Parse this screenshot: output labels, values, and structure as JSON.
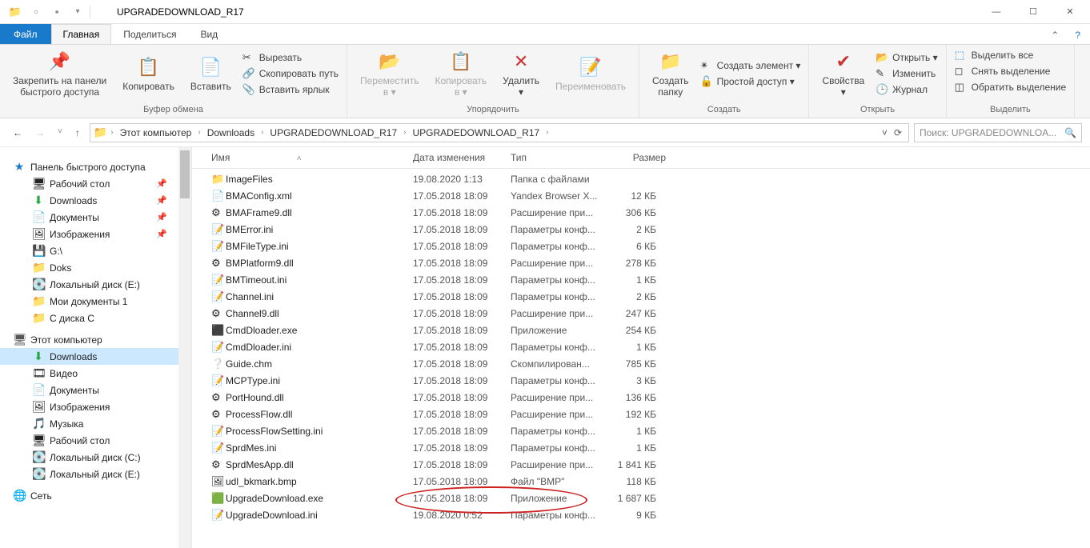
{
  "window": {
    "title": "UPGRADEDOWNLOAD_R17"
  },
  "tabs": {
    "file": "Файл",
    "home": "Главная",
    "share": "Поделиться",
    "view": "Вид"
  },
  "ribbon": {
    "clipboard": {
      "pin": "Закрепить на панели\nбыстрого доступа",
      "copy": "Копировать",
      "paste": "Вставить",
      "cut": "Вырезать",
      "copypath": "Скопировать путь",
      "pasteshort": "Вставить ярлык",
      "label": "Буфер обмена"
    },
    "organize": {
      "moveto": "Переместить\nв ▾",
      "copyto": "Копировать\nв ▾",
      "delete": "Удалить\n▾",
      "rename": "Переименовать",
      "label": "Упорядочить"
    },
    "new": {
      "newfolder": "Создать\nпапку",
      "newitem": "Создать элемент ▾",
      "easyaccess": "Простой доступ ▾",
      "label": "Создать"
    },
    "open": {
      "props": "Свойства\n▾",
      "open": "Открыть ▾",
      "edit": "Изменить",
      "history": "Журнал",
      "label": "Открыть"
    },
    "select": {
      "all": "Выделить все",
      "none": "Снять выделение",
      "invert": "Обратить выделение",
      "label": "Выделить"
    }
  },
  "breadcrumb": [
    "Этот компьютер",
    "Downloads",
    "UPGRADEDOWNLOAD_R17",
    "UPGRADEDOWNLOAD_R17"
  ],
  "search_placeholder": "Поиск: UPGRADEDOWNLOA...",
  "sidebar": {
    "quick": {
      "label": "Панель быстрого доступа",
      "items": [
        {
          "label": "Рабочий стол",
          "pin": true,
          "ico": "🖥"
        },
        {
          "label": "Downloads",
          "pin": true,
          "ico": "⬇",
          "col": "#27a844"
        },
        {
          "label": "Документы",
          "pin": true,
          "ico": "📄"
        },
        {
          "label": "Изображения",
          "pin": true,
          "ico": "🖼"
        },
        {
          "label": "G:\\",
          "pin": false,
          "ico": "💾"
        },
        {
          "label": "Doks",
          "pin": false,
          "ico": "📁",
          "col": "#f8c74a"
        },
        {
          "label": "Локальный диск (E:)",
          "pin": false,
          "ico": "💽"
        },
        {
          "label": "Мои документы 1",
          "pin": false,
          "ico": "📁",
          "col": "#f8c74a"
        },
        {
          "label": "С диска С",
          "pin": false,
          "ico": "📁",
          "col": "#f8c74a"
        }
      ]
    },
    "pc": {
      "label": "Этот компьютер",
      "items": [
        {
          "label": "Downloads",
          "ico": "⬇",
          "selected": true,
          "col": "#27a844"
        },
        {
          "label": "Видео",
          "ico": "🎞"
        },
        {
          "label": "Документы",
          "ico": "📄"
        },
        {
          "label": "Изображения",
          "ico": "🖼"
        },
        {
          "label": "Музыка",
          "ico": "🎵",
          "col": "#1e90ff"
        },
        {
          "label": "Рабочий стол",
          "ico": "🖥"
        },
        {
          "label": "Локальный диск (C:)",
          "ico": "💽"
        },
        {
          "label": "Локальный диск (E:)",
          "ico": "💽"
        }
      ]
    },
    "network": {
      "label": "Сеть"
    }
  },
  "columns": {
    "name": "Имя",
    "date": "Дата изменения",
    "type": "Тип",
    "size": "Размер"
  },
  "files": [
    {
      "ico": "📁",
      "name": "ImageFiles",
      "date": "19.08.2020 1:13",
      "type": "Папка с файлами",
      "size": ""
    },
    {
      "ico": "📄",
      "name": "BMAConfig.xml",
      "date": "17.05.2018 18:09",
      "type": "Yandex Browser X...",
      "size": "12 КБ"
    },
    {
      "ico": "⚙",
      "name": "BMAFrame9.dll",
      "date": "17.05.2018 18:09",
      "type": "Расширение при...",
      "size": "306 КБ"
    },
    {
      "ico": "📝",
      "name": "BMError.ini",
      "date": "17.05.2018 18:09",
      "type": "Параметры конф...",
      "size": "2 КБ"
    },
    {
      "ico": "📝",
      "name": "BMFileType.ini",
      "date": "17.05.2018 18:09",
      "type": "Параметры конф...",
      "size": "6 КБ"
    },
    {
      "ico": "⚙",
      "name": "BMPlatform9.dll",
      "date": "17.05.2018 18:09",
      "type": "Расширение при...",
      "size": "278 КБ"
    },
    {
      "ico": "📝",
      "name": "BMTimeout.ini",
      "date": "17.05.2018 18:09",
      "type": "Параметры конф...",
      "size": "1 КБ"
    },
    {
      "ico": "📝",
      "name": "Channel.ini",
      "date": "17.05.2018 18:09",
      "type": "Параметры конф...",
      "size": "2 КБ"
    },
    {
      "ico": "⚙",
      "name": "Channel9.dll",
      "date": "17.05.2018 18:09",
      "type": "Расширение при...",
      "size": "247 КБ"
    },
    {
      "ico": "⬛",
      "name": "CmdDloader.exe",
      "date": "17.05.2018 18:09",
      "type": "Приложение",
      "size": "254 КБ"
    },
    {
      "ico": "📝",
      "name": "CmdDloader.ini",
      "date": "17.05.2018 18:09",
      "type": "Параметры конф...",
      "size": "1 КБ"
    },
    {
      "ico": "❔",
      "name": "Guide.chm",
      "date": "17.05.2018 18:09",
      "type": "Скомпилирован...",
      "size": "785 КБ"
    },
    {
      "ico": "📝",
      "name": "MCPType.ini",
      "date": "17.05.2018 18:09",
      "type": "Параметры конф...",
      "size": "3 КБ"
    },
    {
      "ico": "⚙",
      "name": "PortHound.dll",
      "date": "17.05.2018 18:09",
      "type": "Расширение при...",
      "size": "136 КБ"
    },
    {
      "ico": "⚙",
      "name": "ProcessFlow.dll",
      "date": "17.05.2018 18:09",
      "type": "Расширение при...",
      "size": "192 КБ"
    },
    {
      "ico": "📝",
      "name": "ProcessFlowSetting.ini",
      "date": "17.05.2018 18:09",
      "type": "Параметры конф...",
      "size": "1 КБ"
    },
    {
      "ico": "📝",
      "name": "SprdMes.ini",
      "date": "17.05.2018 18:09",
      "type": "Параметры конф...",
      "size": "1 КБ"
    },
    {
      "ico": "⚙",
      "name": "SprdMesApp.dll",
      "date": "17.05.2018 18:09",
      "type": "Расширение при...",
      "size": "1 841 КБ"
    },
    {
      "ico": "🖼",
      "name": "udl_bkmark.bmp",
      "date": "17.05.2018 18:09",
      "type": "Файл \"BMP\"",
      "size": "118 КБ"
    },
    {
      "ico": "🟩",
      "name": "UpgradeDownload.exe",
      "date": "17.05.2018 18:09",
      "type": "Приложение",
      "size": "1 687 КБ"
    },
    {
      "ico": "📝",
      "name": "UpgradeDownload.ini",
      "date": "19.08.2020 0:52",
      "type": "Параметры конф...",
      "size": "9 КБ"
    }
  ]
}
